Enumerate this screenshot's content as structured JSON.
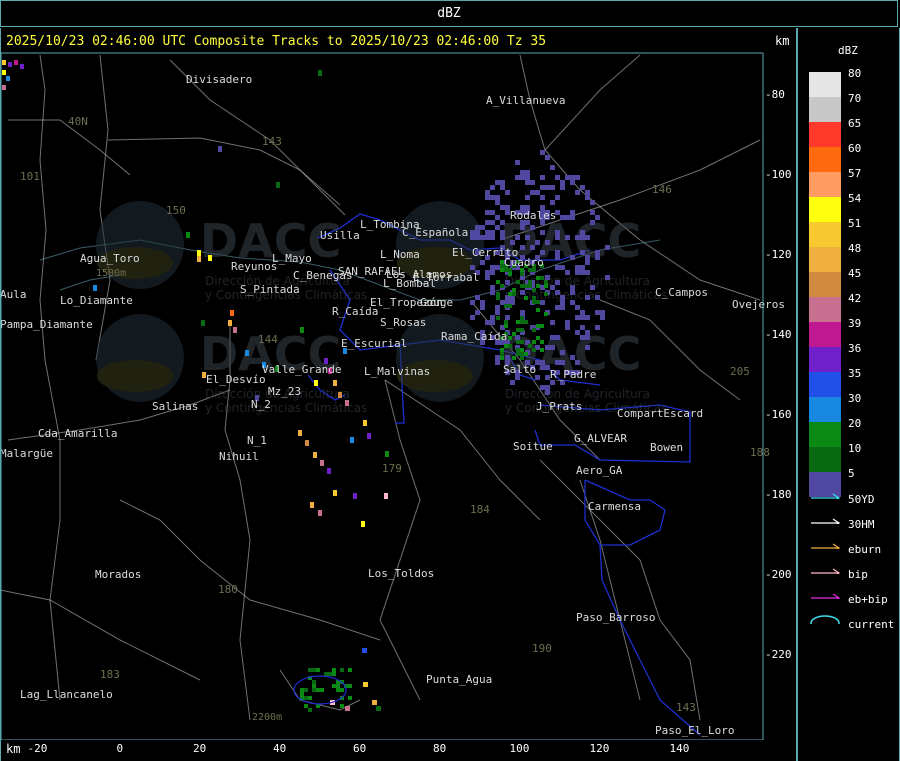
{
  "header": {
    "product": "dBZ",
    "title": "2025/10/23 02:46:00 UTC Composite Tracks to 2025/10/23 02:46:00 Tz 35",
    "unit_top": "km",
    "unit_bottom": "km"
  },
  "axes": {
    "x_ticks": [
      "-20",
      "0",
      "20",
      "40",
      "60",
      "80",
      "100",
      "120",
      "140"
    ],
    "y_ticks": [
      "-80",
      "-100",
      "-120",
      "-140",
      "-160",
      "-180",
      "-200",
      "-220"
    ]
  },
  "legend": {
    "title": "dBZ",
    "scale": [
      {
        "value": "80",
        "color": "#e6e6e6"
      },
      {
        "value": "70",
        "color": "#c8c8c8"
      },
      {
        "value": "65",
        "color": "#ff3a2a"
      },
      {
        "value": "60",
        "color": "#ff6a10"
      },
      {
        "value": "57",
        "color": "#ff9a60"
      },
      {
        "value": "54",
        "color": "#ffff10"
      },
      {
        "value": "51",
        "color": "#f8c830"
      },
      {
        "value": "48",
        "color": "#f0b040"
      },
      {
        "value": "45",
        "color": "#d08a40"
      },
      {
        "value": "42",
        "color": "#c87090"
      },
      {
        "value": "39",
        "color": "#c01890"
      },
      {
        "value": "36",
        "color": "#7020c8"
      },
      {
        "value": "35",
        "color": "#2050e8"
      },
      {
        "value": "30",
        "color": "#1888e0"
      },
      {
        "value": "20",
        "color": "#0a8a14"
      },
      {
        "value": "10",
        "color": "#0a6a14"
      },
      {
        "value": "5",
        "color": "#5048a0"
      }
    ],
    "tracks": [
      {
        "label": "50YD",
        "color": "#40e0f0"
      },
      {
        "label": "30HM",
        "color": "#ffffff"
      },
      {
        "label": "eburn",
        "color": "#f0b040"
      },
      {
        "label": "bip",
        "color": "#ffb8c8"
      },
      {
        "label": "eb+bip",
        "color": "#e030e0"
      },
      {
        "label": "current",
        "color": "#40e0f0"
      }
    ]
  },
  "places": [
    "Divisadero",
    "A_Villanueva",
    "Usilla",
    "L_Tombina",
    "C_Española",
    "Rodales",
    "Agua_Toro",
    "Reyunos",
    "L_Mayo",
    "C_Benegas",
    "SAN_RAFAEL",
    "Los_Alamos",
    "L_Noma",
    "El_Cerrito",
    "Cuadro",
    "S_Pintada",
    "E_Torrabal",
    "L_Bombal",
    "C_Campos",
    "Ovejeros",
    "El_Tropezón",
    "Gouge",
    "R_Caída",
    "S_Rosas",
    "Rama_Caída",
    "E_Escurial",
    "Valle_Grande",
    "L_Malvinas",
    "Salto",
    "R_Padre",
    "El_Desvío",
    "Salinas",
    "Mz_23",
    "N_2",
    "N_1",
    "Nihuil",
    "J_Prats",
    "CompartEscard",
    "G_ALVEAR",
    "Bowen",
    "Soitue",
    "Aero_GA",
    "Carmensa",
    "Cda_Amarilla",
    "Pampa_Diamante",
    "Lo_Diamante",
    "Morados",
    "Los_Toldos",
    "Paso_Barroso",
    "Punta_Agua",
    "Lag_Llancanelo",
    "Paso_El_Loro",
    "Malargüe",
    "Aula"
  ],
  "route_labels": [
    "143",
    "146",
    "40N",
    "101",
    "150",
    "144",
    "179",
    "184",
    "180",
    "183",
    "190",
    "188",
    "205",
    "143"
  ],
  "elevation_labels": [
    "1500m",
    "2200m"
  ],
  "watermark": {
    "brand": "DACC",
    "line1": "Dirección de Agricultura",
    "line2": "y Contingencias Climáticas"
  }
}
